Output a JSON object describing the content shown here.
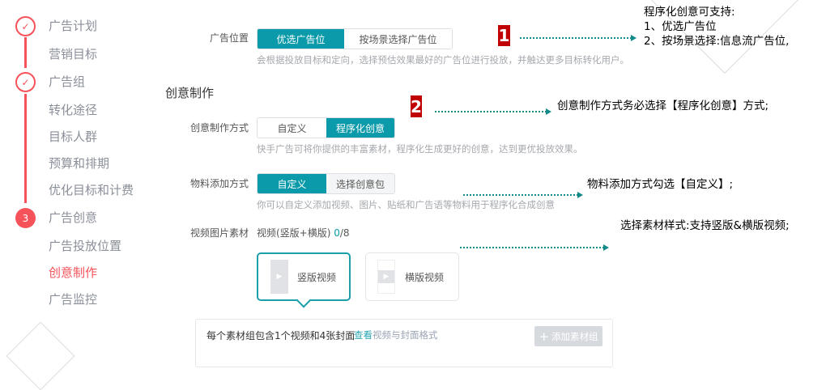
{
  "sidebar": {
    "steps": [
      {
        "type": "check",
        "icon": "check-icon"
      },
      {
        "type": "check",
        "icon": "check-icon"
      },
      {
        "type": "number",
        "label": "3"
      }
    ],
    "items": [
      {
        "label": "广告计划"
      },
      {
        "label": "营销目标"
      },
      {
        "label": "广告组"
      },
      {
        "label": "转化途径"
      },
      {
        "label": "目标人群"
      },
      {
        "label": "预算和排期"
      },
      {
        "label": "优化目标和计费"
      },
      {
        "label": "广告创意"
      },
      {
        "label": "广告投放位置"
      },
      {
        "label": "创意制作",
        "active": true
      },
      {
        "label": "广告监控"
      }
    ]
  },
  "placement": {
    "label": "广告位置",
    "options": [
      "优选广告位",
      "按场景选择广告位"
    ],
    "selected": "优选广告位",
    "hint": "会根据投放目标和定向，选择预估效果最好的广告位进行投放，并触达更多目标转化用户。"
  },
  "section_title": "创意制作",
  "creative_mode": {
    "label": "创意制作方式",
    "options": [
      "自定义",
      "程序化创意"
    ],
    "selected": "程序化创意",
    "hint": "快手广告可将你提供的丰富素材，程序化生成更好的创意，达到更优投放效果。"
  },
  "material_mode": {
    "label": "物料添加方式",
    "options": [
      "自定义",
      "选择创意包"
    ],
    "selected": "自定义",
    "hint": "你可以自定义添加视频、图片、贴纸和广告语等物料用于程序化合成创意"
  },
  "media": {
    "label": "视频图片素材",
    "value_prefix": "视频(竖版+横版) ",
    "count": "0",
    "total": "/8",
    "cards": [
      "竖版视频",
      "横版视频"
    ],
    "selected": "竖版视频"
  },
  "group_box": {
    "text": "每个素材组包含1个视频和4张封面",
    "link_highlight": "查看",
    "link_rest": "视频与封面格式",
    "add_button": "添加素材组"
  },
  "annotations": {
    "badge1": "1",
    "badge2": "2",
    "note1": [
      "程序化创意可支持:",
      "1、优选广告位",
      "2、按场景选择:信息流广告位,"
    ],
    "note2": "创意制作方式务必选择【程序化创意】方式;",
    "note3": "物料添加方式勾选【自定义】;",
    "note4": "选择素材样式:支持竖版&横版视频;"
  },
  "colors": {
    "accent": "#0a9aa9",
    "step": "#f5525a",
    "badge": "#c00000"
  }
}
